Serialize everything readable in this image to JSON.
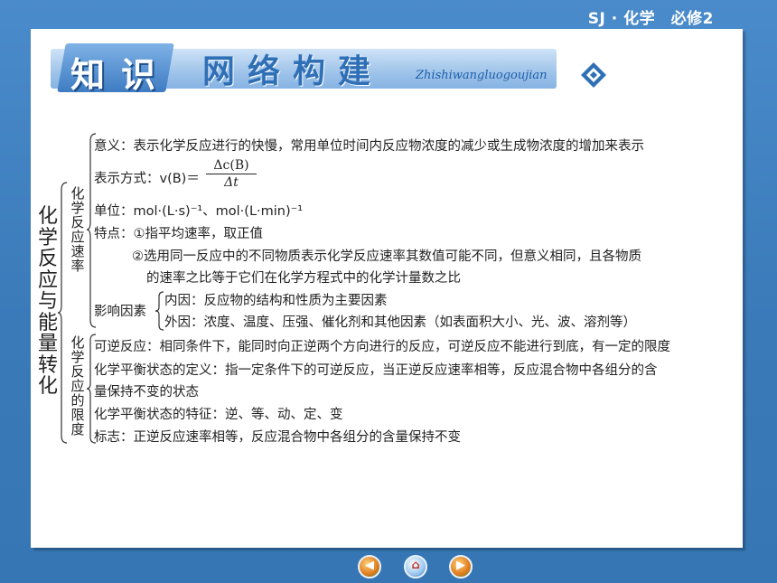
{
  "header": {
    "course_label": "SJ · 化学　必修2"
  },
  "banner": {
    "zhi": "知",
    "shi": "识",
    "wangluogoujian": "网络构建",
    "pinyin": "Zhishiwangluogoujian",
    "icon": "diamond-arrow-icon"
  },
  "map": {
    "root": "化学反应与能量转化",
    "rate": {
      "label": "化学反应速率",
      "meaning": "意义：表示化学反应进行的快慢，常用单位时间内反应物浓度的减少或生成物浓度的增加来表示",
      "expression_prefix": "表示方式：v(B)＝",
      "expression_num": "Δc(B)",
      "expression_den": "Δt",
      "unit": "单位：mol·(L·s)⁻¹、mol·(L·min)⁻¹",
      "feature_1": "特点：①指平均速率，取正值",
      "feature_2a": "②选用同一反应中的不同物质表示化学反应速率其数值可能不同，但意义相同，且各物质",
      "feature_2b": "的速率之比等于它们在化学方程式中的化学计量数之比",
      "factors_label": "影响因素",
      "internal": "内因：反应物的结构和性质为主要因素",
      "external": "外因：浓度、温度、压强、催化剂和其他因素（如表面积大小、光、波、溶剂等）"
    },
    "limit": {
      "label": "化学反应的限度",
      "reversible": "可逆反应：相同条件下，能同时向正逆两个方向进行的反应，可逆反应不能进行到底，有一定的限度",
      "equilibrium_a": "化学平衡状态的定义：指一定条件下的可逆反应，当正逆反应速率相等，反应混合物中各组分的含",
      "equilibrium_b": "量保持不变的状态",
      "features": "化学平衡状态的特征：逆、等、动、定、变",
      "sign": "标志：正逆反应速率相等，反应混合物中各组分的含量保持不变"
    }
  },
  "nav": {
    "prev_icon": "prev-page-icon",
    "home_icon": "home-icon",
    "next_icon": "next-page-icon"
  },
  "colors": {
    "background": "#3f7fbf",
    "card": "#ffffff",
    "accent": "#2f6fb6"
  }
}
